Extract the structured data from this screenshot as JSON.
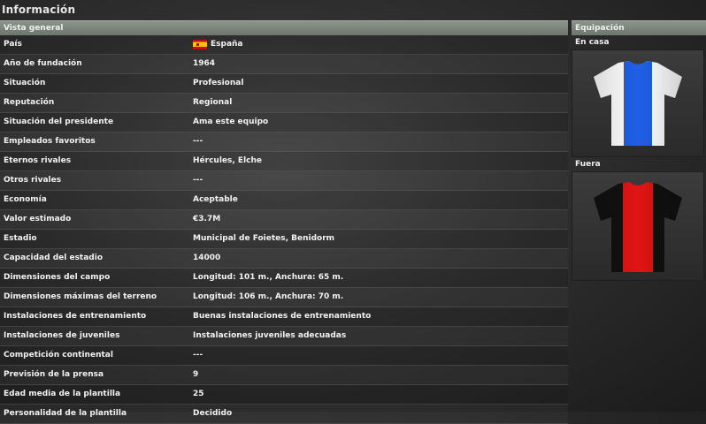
{
  "page": {
    "title": "Información"
  },
  "general": {
    "header": "Vista general",
    "rows": [
      {
        "label": "País",
        "value": "España",
        "flag": "spain-flag"
      },
      {
        "label": "Año de fundación",
        "value": "1964"
      },
      {
        "label": "Situación",
        "value": "Profesional"
      },
      {
        "label": "Reputación",
        "value": "Regional"
      },
      {
        "label": "Situación del presidente",
        "value": "Ama este equipo"
      },
      {
        "label": "Empleados favoritos",
        "value": "---"
      },
      {
        "label": "Eternos rivales",
        "value": "Hércules, Elche"
      },
      {
        "label": "Otros rivales",
        "value": "---"
      },
      {
        "label": "Economía",
        "value": "Aceptable"
      },
      {
        "label": "Valor estimado",
        "value": "€3.7M"
      },
      {
        "label": "Estadio",
        "value": "Municipal de Foietes, Benidorm"
      },
      {
        "label": "Capacidad del estadio",
        "value": "14000"
      },
      {
        "label": "Dimensiones del campo",
        "value": "Longitud: 101 m., Anchura: 65 m."
      },
      {
        "label": "Dimensiones máximas del terreno",
        "value": "Longitud: 106 m., Anchura: 70 m."
      },
      {
        "label": "Instalaciones de entrenamiento",
        "value": "Buenas instalaciones de entrenamiento"
      },
      {
        "label": "Instalaciones de juveniles",
        "value": "Instalaciones juveniles adecuadas"
      },
      {
        "label": "Competición continental",
        "value": "---"
      },
      {
        "label": "Previsión de la prensa",
        "value": "9"
      },
      {
        "label": "Edad media de la plantilla",
        "value": "25"
      },
      {
        "label": "Personalidad de la plantilla",
        "value": "Decidido"
      }
    ]
  },
  "kit": {
    "header": "Equipación",
    "home": {
      "label": "En casa",
      "icon": "home-shirt-icon",
      "body_color": "#ffffff",
      "stripe_color": "#1f5fe6",
      "collar_color": "#1f5fe6"
    },
    "away": {
      "label": "Fuera",
      "icon": "away-shirt-icon",
      "body_color": "#111111",
      "stripe_color": "#e01414",
      "collar_color": "#e01414"
    }
  }
}
